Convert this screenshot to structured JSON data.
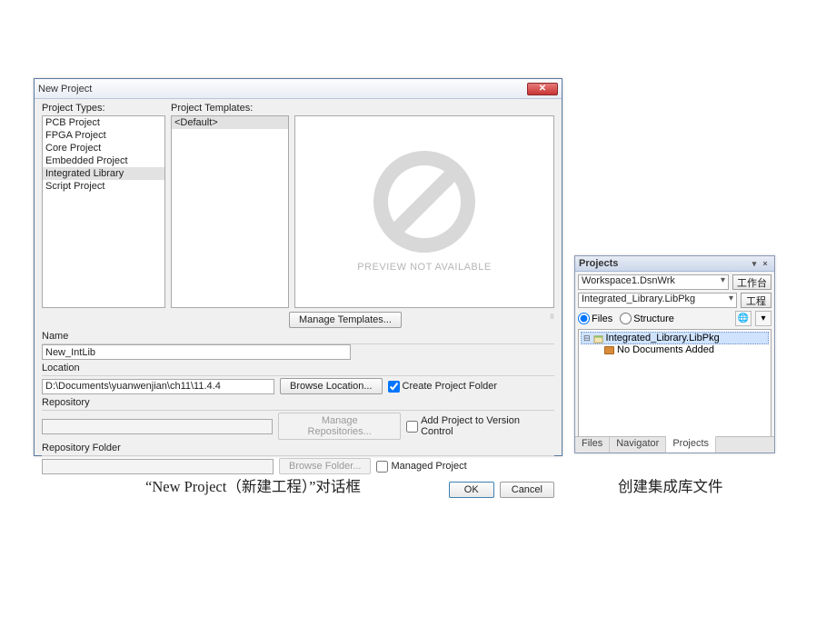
{
  "dialog": {
    "title": "New Project",
    "labels": {
      "project_types": "Project Types:",
      "project_templates": "Project Templates:",
      "preview_na": "PREVIEW NOT AVAILABLE",
      "manage_templates": "Manage Templates...",
      "name": "Name",
      "location": "Location",
      "browse_location": "Browse Location...",
      "create_project_folder": "Create Project Folder",
      "repository": "Repository",
      "manage_repositories": "Manage Repositories...",
      "add_to_vc": "Add Project to Version Control",
      "repository_folder": "Repository Folder",
      "browse_folder": "Browse Folder...",
      "managed_project": "Managed Project",
      "ok": "OK",
      "cancel": "Cancel"
    },
    "project_types": [
      "PCB Project",
      "FPGA Project",
      "Core Project",
      "Embedded Project",
      "Integrated Library",
      "Script Project"
    ],
    "project_types_selected_index": 4,
    "templates": [
      "<Default>"
    ],
    "templates_selected_index": 0,
    "fields": {
      "name_value": "New_IntLib",
      "location_value": "D:\\Documents\\yuanwenjian\\ch11\\11.4.4",
      "repository_value": "",
      "repository_folder_value": ""
    },
    "checks": {
      "create_project_folder": true,
      "add_to_vc": false,
      "managed_project": false
    }
  },
  "panel": {
    "title": "Projects",
    "pin_glyph": "▾",
    "close_glyph": "×",
    "workspace_value": "Workspace1.DsnWrk",
    "workspace_btn": "工作台",
    "project_value": "Integrated_Library.LibPkg",
    "project_btn": "工程",
    "view": {
      "files": "Files",
      "structure": "Structure",
      "selected": "files"
    },
    "tree": {
      "root": "Integrated_Library.LibPkg",
      "child": "No Documents Added"
    },
    "tabs": {
      "files": "Files",
      "navigator": "Navigator",
      "projects": "Projects",
      "active": "projects"
    }
  },
  "captions": {
    "left": "“New Project（新建工程）”对话框",
    "right": "创建集成库文件"
  }
}
